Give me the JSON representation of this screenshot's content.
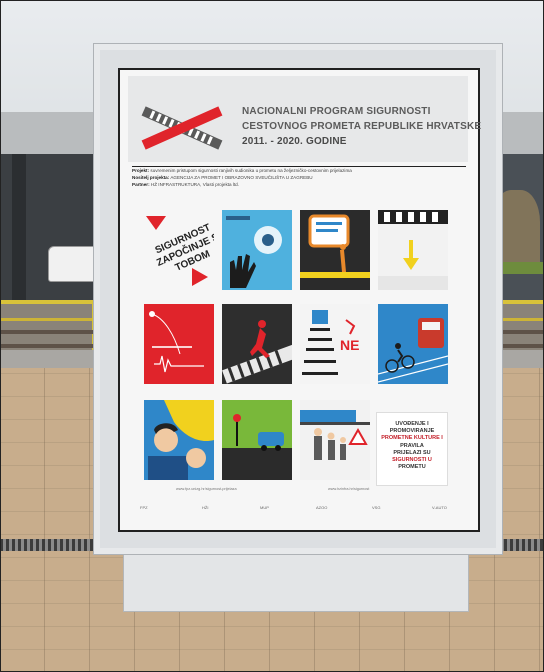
{
  "poster": {
    "title_line_1": "NACIONALNI PROGRAM SIGURNOSTI",
    "title_line_2": "CESTOVNOG PROMETA REPUBLIKE HRVATSKE",
    "title_line_3": "2011. - 2020. GODINE",
    "project_label": "Projekt:",
    "project_text": "suvremenim pristupom sigurnosti ranjivih sudionika u prometu na željezničko-cestovnim prijelazima",
    "lead_label": "Nositelj projekta:",
    "lead_text": "AGENCIJA ZA PROMET I OBRAZOVNO SVEUČILIŠTA U ZAGREBU",
    "partner_label": "Partner:",
    "partner_text": "HŽ INFRASTRUKTURA, Vlasti projekta ltd.",
    "slogan": "SIGURNOST ZAPOČINJE S TOBOM",
    "tile_ne": "NE",
    "closing_lines": [
      "UVOĐENJE I",
      "PROMOVIRANJE",
      "PROMETNE KULTURE I",
      "PRAVILA",
      "PRIJELAZI SU",
      "SIGURNOSTI U",
      "PROMETU"
    ],
    "footer_url_left": "www.fpz.unizg.hr/sigurnost-prijelaza",
    "footer_url_right": "www.hzinfra.hr/sigurnost",
    "logo_marks": [
      "FPZ",
      "HŽI",
      "MUP",
      "AZOO",
      "VSG",
      "V-AUTO"
    ]
  },
  "colors": {
    "poster_red": "#e0242b",
    "poster_blue": "#2f87c9",
    "poster_yellow": "#f1d11e",
    "poster_green": "#79b83a",
    "poster_dark": "#222222"
  }
}
